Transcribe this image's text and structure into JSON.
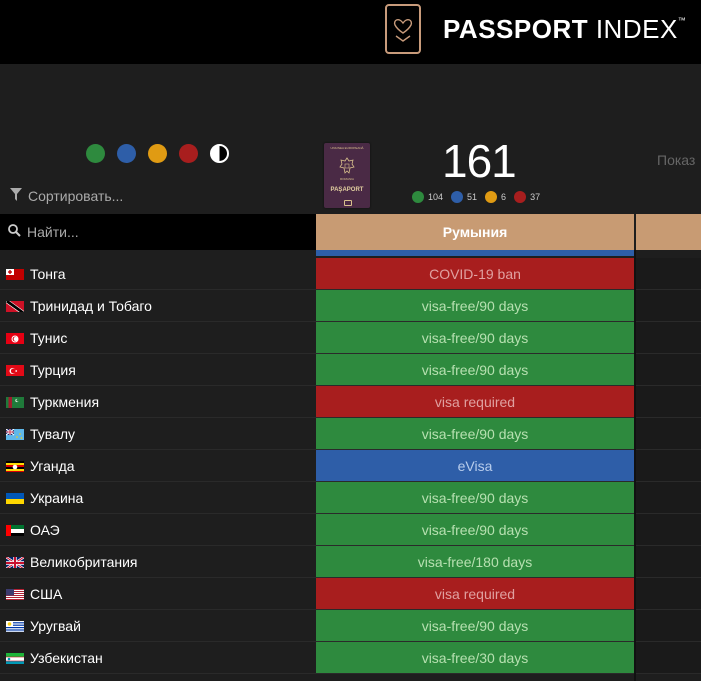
{
  "header": {
    "brand_bold": "PASSPORT",
    "brand_thin": " INDEX",
    "tm": "™"
  },
  "filters": {
    "colors": [
      "#2e8a3e",
      "#2e5ea8",
      "#e09b13",
      "#a81e1e"
    ],
    "sort_label": "Сортировать..."
  },
  "passport": {
    "top_text": "UNIUNEA EUROPEANĂ",
    "country_text": "ROMANIA",
    "label": "PAŞAPORT"
  },
  "score": {
    "total": "161",
    "breakdown": [
      {
        "color": "#2e8a3e",
        "count": "104"
      },
      {
        "color": "#2e5ea8",
        "count": "51"
      },
      {
        "color": "#e09b13",
        "count": "6"
      },
      {
        "color": "#a81e1e",
        "count": "37"
      }
    ]
  },
  "show_more": "Показ",
  "search": {
    "placeholder": "Найти..."
  },
  "table": {
    "column": "Румыния",
    "rows": [
      {
        "country": "Тонга",
        "status": "COVID-19 ban",
        "color": "#a81e1e",
        "text_color": "#e0a0a0",
        "flag": "tonga"
      },
      {
        "country": "Тринидад и Тобаго",
        "status": "visa-free/90 days",
        "color": "#2e8a3e",
        "text_color": "#b6e0b0",
        "flag": "trinidad"
      },
      {
        "country": "Тунис",
        "status": "visa-free/90 days",
        "color": "#2e8a3e",
        "text_color": "#b6e0b0",
        "flag": "tunisia"
      },
      {
        "country": "Турция",
        "status": "visa-free/90 days",
        "color": "#2e8a3e",
        "text_color": "#b6e0b0",
        "flag": "turkey"
      },
      {
        "country": "Туркмения",
        "status": "visa required",
        "color": "#a81e1e",
        "text_color": "#e0a0a0",
        "flag": "turkmenistan"
      },
      {
        "country": "Тувалу",
        "status": "visa-free/90 days",
        "color": "#2e8a3e",
        "text_color": "#b6e0b0",
        "flag": "tuvalu"
      },
      {
        "country": "Уганда",
        "status": "eVisa",
        "color": "#2e5ea8",
        "text_color": "#b8cdec",
        "flag": "uganda"
      },
      {
        "country": "Украина",
        "status": "visa-free/90 days",
        "color": "#2e8a3e",
        "text_color": "#b6e0b0",
        "flag": "ukraine"
      },
      {
        "country": "ОАЭ",
        "status": "visa-free/90 days",
        "color": "#2e8a3e",
        "text_color": "#b6e0b0",
        "flag": "uae"
      },
      {
        "country": "Великобритания",
        "status": "visa-free/180 days",
        "color": "#2e8a3e",
        "text_color": "#b6e0b0",
        "flag": "uk"
      },
      {
        "country": "США",
        "status": "visa required",
        "color": "#a81e1e",
        "text_color": "#e0a0a0",
        "flag": "usa"
      },
      {
        "country": "Уругвай",
        "status": "visa-free/90 days",
        "color": "#2e8a3e",
        "text_color": "#b6e0b0",
        "flag": "uruguay"
      },
      {
        "country": "Узбекистан",
        "status": "visa-free/30 days",
        "color": "#2e8a3e",
        "text_color": "#b6e0b0",
        "flag": "uzbekistan"
      }
    ]
  }
}
